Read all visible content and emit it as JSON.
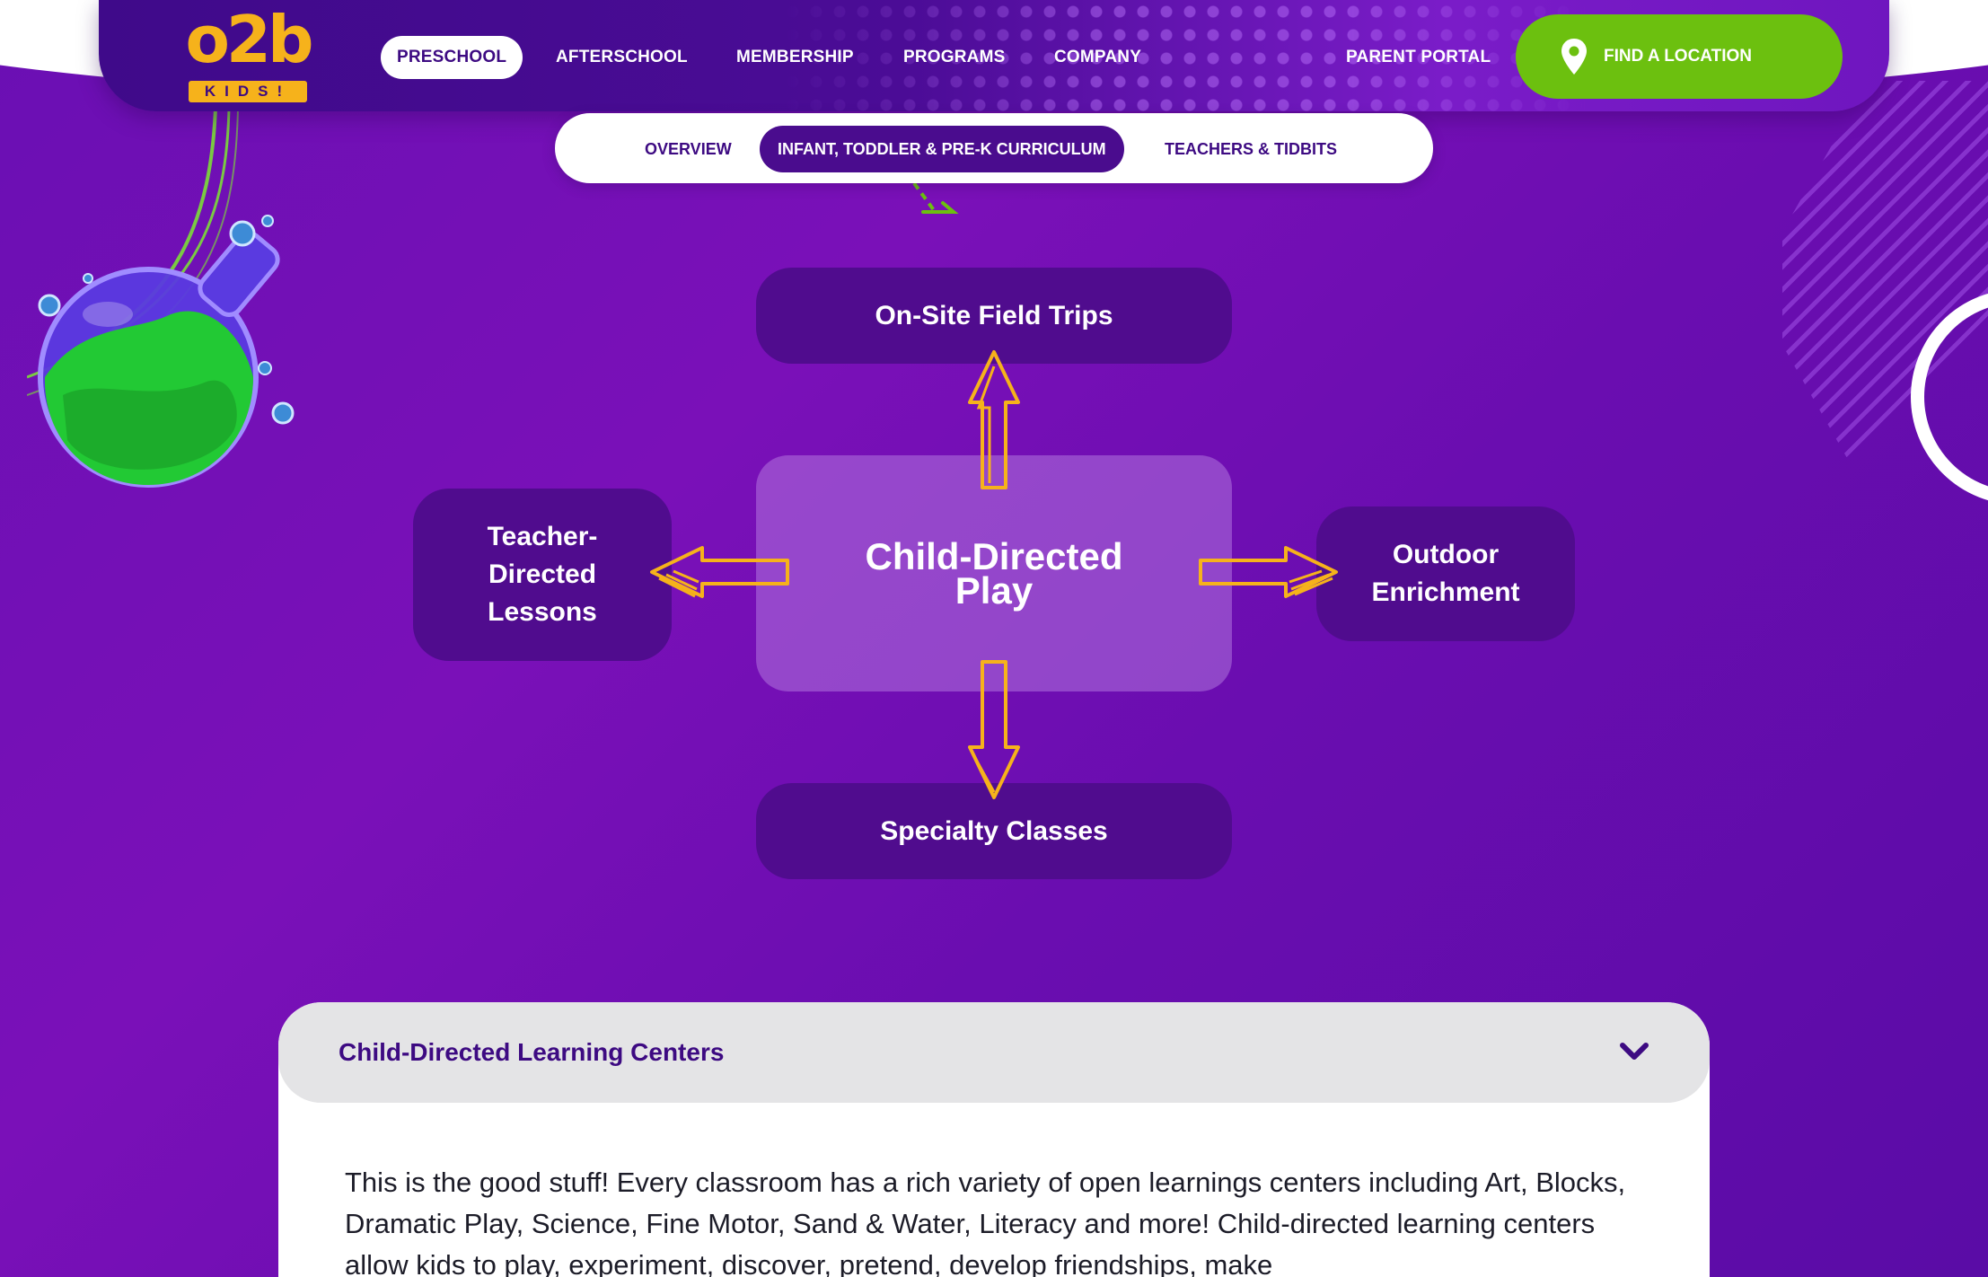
{
  "brand": {
    "logo_word": "o2b",
    "logo_sub": "KIDS!"
  },
  "nav": {
    "items": [
      {
        "label": "PRESCHOOL",
        "active": true
      },
      {
        "label": "AFTERSCHOOL",
        "active": false
      },
      {
        "label": "MEMBERSHIP",
        "active": false
      },
      {
        "label": "PROGRAMS",
        "active": false
      },
      {
        "label": "COMPANY",
        "active": false
      }
    ],
    "parent_portal": "PARENT PORTAL",
    "find_location": "FIND A LOCATION"
  },
  "subnav": {
    "items": [
      {
        "label": "OVERVIEW",
        "active": false
      },
      {
        "label": "INFANT, TODDLER & PRE-K CURRICULUM",
        "active": true
      },
      {
        "label": "TEACHERS & TIDBITS",
        "active": false
      }
    ]
  },
  "diagram": {
    "center": "Child-Directed Play",
    "top": "On-Site Field Trips",
    "left": "Teacher-Directed Lessons",
    "right": "Outdoor Enrichment",
    "bottom": "Specialty Classes"
  },
  "accordion": {
    "title": "Child-Directed Learning Centers",
    "body": "This is the good stuff! Every classroom has a rich variety of open learnings centers including Art, Blocks, Dramatic Play, Science, Fine Motor, Sand & Water, Literacy and more! Child-directed learning centers allow kids to play, experiment, discover, pretend, develop friendships, make"
  },
  "colors": {
    "brand_purple": "#3d0a82",
    "field_purple": "#6a0fb3",
    "brand_yellow": "#f6b21b",
    "cta_green": "#6cc00f",
    "arrow_yellow": "#f6b21b"
  },
  "icons": [
    "location-pin-icon",
    "chevron-down-icon",
    "flask-illustration",
    "arrow-icon"
  ]
}
